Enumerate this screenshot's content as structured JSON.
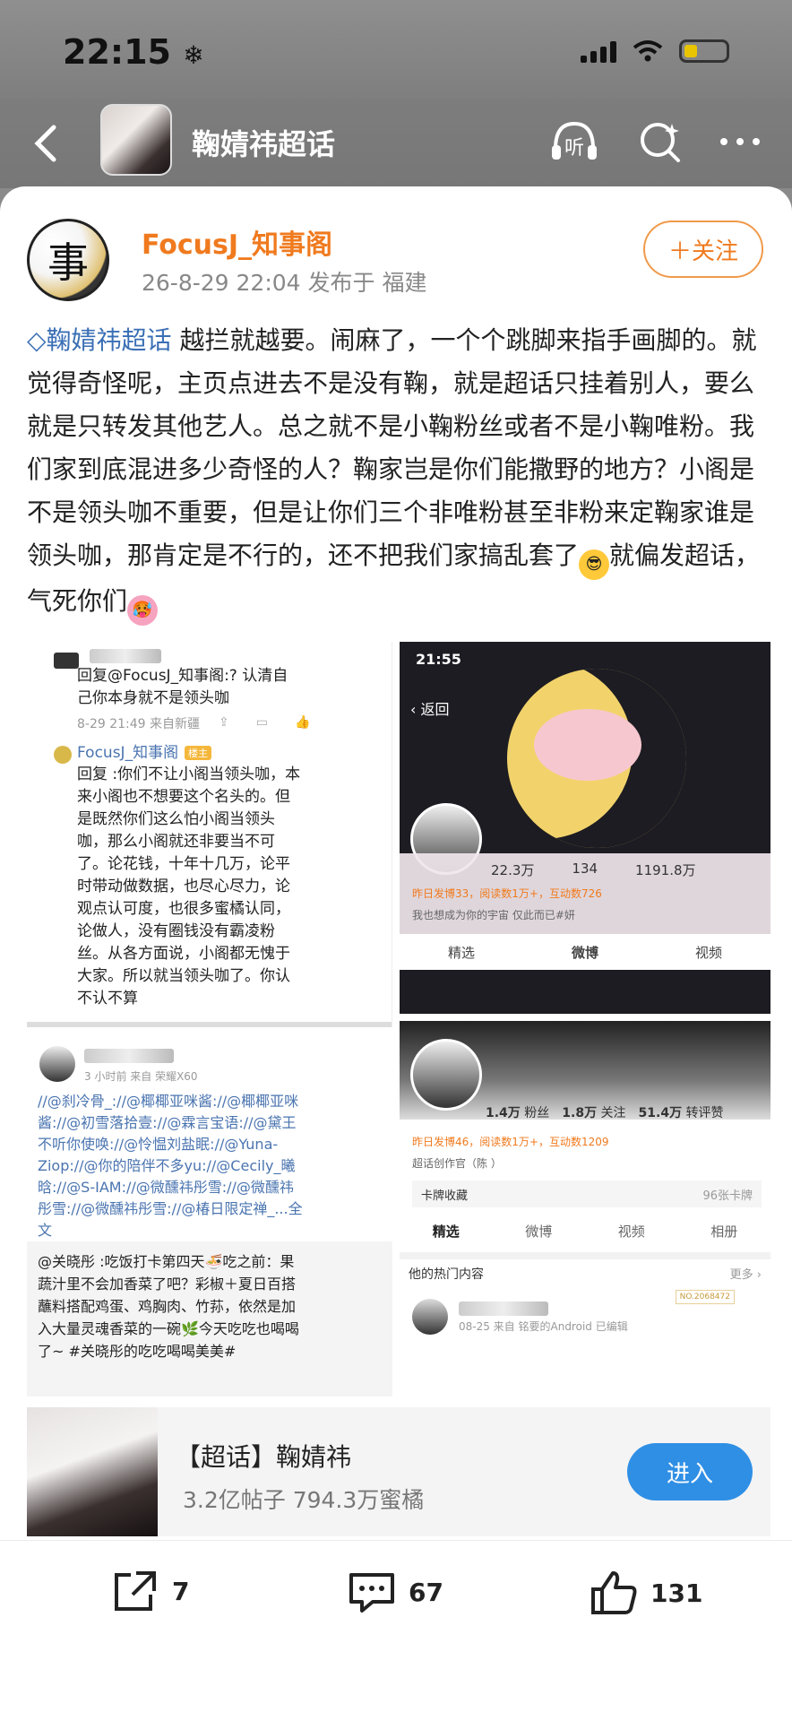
{
  "status": {
    "time": "22:15",
    "snow": "❄"
  },
  "nav": {
    "title": "鞠婧祎超话",
    "listen_label": "听"
  },
  "post": {
    "author": "FocusJ_知事阁",
    "avatar_text": "事",
    "meta": "26-8-29 22:04  发布于 福建",
    "follow_label": "＋关注",
    "topic_tag": "鞠婧祎超话",
    "text": " 越拦就越要。闹麻了，一个个跳脚来指手画脚的。就觉得奇怪呢，主页点进去不是没有鞠，就是超话只挂着别人，要么就是只转发其他艺人。总之就不是小鞠粉丝或者不是小鞠唯粉。我们家到底混进多少奇怪的人？鞠家岂是你们能撒野的地方？小阁是不是领头咖不重要，但是让你们三个非唯粉甚至非粉来定鞠家谁是领头咖，那肯定是不行的，还不把我们家搞乱套了",
    "text_tail": "就偏发超话，气死你们"
  },
  "img1": {
    "reply1": "回复@FocusJ_知事阁:? 认清自己你本身就不是领头咖",
    "reply1_meta": "8-29 21:49 来自新疆",
    "author": "FocusJ_知事阁",
    "badge": "楼主",
    "reply2": "回复        :你们不让小阁当领头咖，本来小阁也不想要这个名头的。但是既然你们这么怕小阁当领头咖，那么小阁就还非要当不可了。论花钱，十年十几万，论平时带动做数据，也尽心尽力，论观点认可度，也很多蜜橘认同，论做人，没有圈钱没有霸凌粉丝。从各方面说，小阁都无愧于大家。所以就当领头咖了。你认不认不算"
  },
  "img2": {
    "time": "21:55",
    "back": "返回",
    "stat1": "22.3万",
    "stat2": "134",
    "stat3": "1191.8万",
    "line": "昨日发博33，阅读数1万+，互动数726",
    "motto": "我也想成为你的宇宙 仅此而已#妍",
    "tabs": [
      "精选",
      "微博",
      "视频"
    ]
  },
  "img3": {
    "meta": "3 小时前  来自 荣耀X60",
    "text": "//@刹冷骨_://@椰椰亚咪酱://@椰椰亚咪酱://@初雪落拾壹://@霖言宝语://@黛王不听你使唤://@怜愠刘盐眠://@Yuna-Ziop://@你的陪伴不多yu://@Cecily_曦晗://@S-IAM://@微醺祎彤雪://@微醺祎彤雪://@微醺祎彤雪://@椿日限定禅_...全文",
    "more": "全文",
    "quote": "@关晓彤 :吃饭打卡第四天🍜吃之前：果蔬汁里不会加香菜了吧？彩椒＋夏日百搭蘸料搭配鸡蛋、鸡胸肉、竹荪，依然是加入大量灵魂香菜的一碗🌿今天吃吃也喝喝了~ #关晓彤的吃吃喝喝美美#"
  },
  "img4": {
    "stat1": "1.4万",
    "stat1_label": "粉丝",
    "stat2": "1.8万",
    "stat2_label": "关注",
    "stat3": "51.4万",
    "stat3_label": "转评赞",
    "line": "昨日发博46，阅读数1万+，互动数1209",
    "officer": "超话创作官（陈        ）",
    "cards": "卡牌收藏",
    "cards_count": "96张卡牌",
    "tabs": [
      "精选",
      "微博",
      "视频",
      "相册"
    ],
    "hot": "他的热门内容",
    "hot_more": "更多",
    "hot_meta": "08-25 来自 铭要的Android 已编辑",
    "no": "NO.2068472"
  },
  "topic": {
    "title": "【超话】鞠婧祎",
    "sub": "3.2亿帖子 794.3万蜜橘",
    "enter": "进入"
  },
  "actions": {
    "share": "7",
    "comment": "67",
    "like": "131"
  }
}
